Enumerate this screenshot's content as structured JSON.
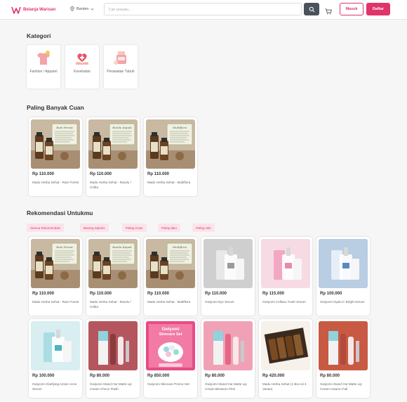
{
  "header": {
    "logo_text": "Belanja Warisan",
    "location": "Banten",
    "search_placeholder": "Cari sesuatu...",
    "login_label": "Masuk",
    "register_label": "Daftar"
  },
  "sections": {
    "categories_title": "Kategori",
    "best_title": "Paling Banyak Cuan",
    "recommend_title": "Rekomendasi Untukmu"
  },
  "categories": [
    {
      "label": "Fashion / Apparel",
      "icon": "tshirt-icon"
    },
    {
      "label": "Kesehatan",
      "icon": "health-heart-icon"
    },
    {
      "label": "Perawatan Tubuh",
      "icon": "body-care-icon"
    }
  ],
  "best_products": [
    {
      "price": "Rp 110.000",
      "name": "Madu Herba Sehat - Rain Forest"
    },
    {
      "price": "Rp 110.000",
      "name": "Madu Herba Sehat - Randu / Celba"
    },
    {
      "price": "Rp 110.000",
      "name": "Madu Herba Sehat - Multiflora"
    }
  ],
  "filter_chips": [
    "Semua Rekomendasi",
    "Barang Sejenis",
    "Paling Cuan",
    "Paling laku",
    "Paling Hits"
  ],
  "recommend_row1": [
    {
      "price": "Rp 110.000",
      "name": "Madu Herba Sehat - Rain Forest"
    },
    {
      "price": "Rp 110.000",
      "name": "Madu Herba Sehat - Randu / Celba"
    },
    {
      "price": "Rp 110.000",
      "name": "Madu Herba Sehat - Multiflora"
    },
    {
      "price": "Rp 110.000",
      "name": "Gwiyomi Eye Serum"
    },
    {
      "price": "Rp 115.000",
      "name": "Gwiyomi Collasu Youth Serum"
    },
    {
      "price": "Rp 100.000",
      "name": "Gwiyomi Hyalu-C Bright Serum"
    }
  ],
  "recommend_row2": [
    {
      "price": "Rp 100.000",
      "name": "Gwiyomi Clarifying Action Acne Serum"
    },
    {
      "price": "Rp 80.000",
      "name": "Gwiyomi Stand Out Matte Lip Cream Choco Flash"
    },
    {
      "price": "Rp 850.000",
      "name": "Gwiyomi Skincare Promo Set"
    },
    {
      "price": "Rp 80.000",
      "name": "Gwiyomi Stand Out Matte Lip Cream Blossom Pink"
    },
    {
      "price": "Rp 420.000",
      "name": "Madu Herba Sehat (1 Box isi 4 Varian)"
    },
    {
      "price": "Rp 80.000",
      "name": "Gwiyomi Stand Out Matte Lip Cream Autumn Fall"
    }
  ],
  "promo_image_text": {
    "title": "Gwiyomi Skincare Set"
  },
  "colors": {
    "brand": "#e0356a",
    "chip_bg": "#fbe4ea",
    "search_btn": "#4b525b"
  }
}
